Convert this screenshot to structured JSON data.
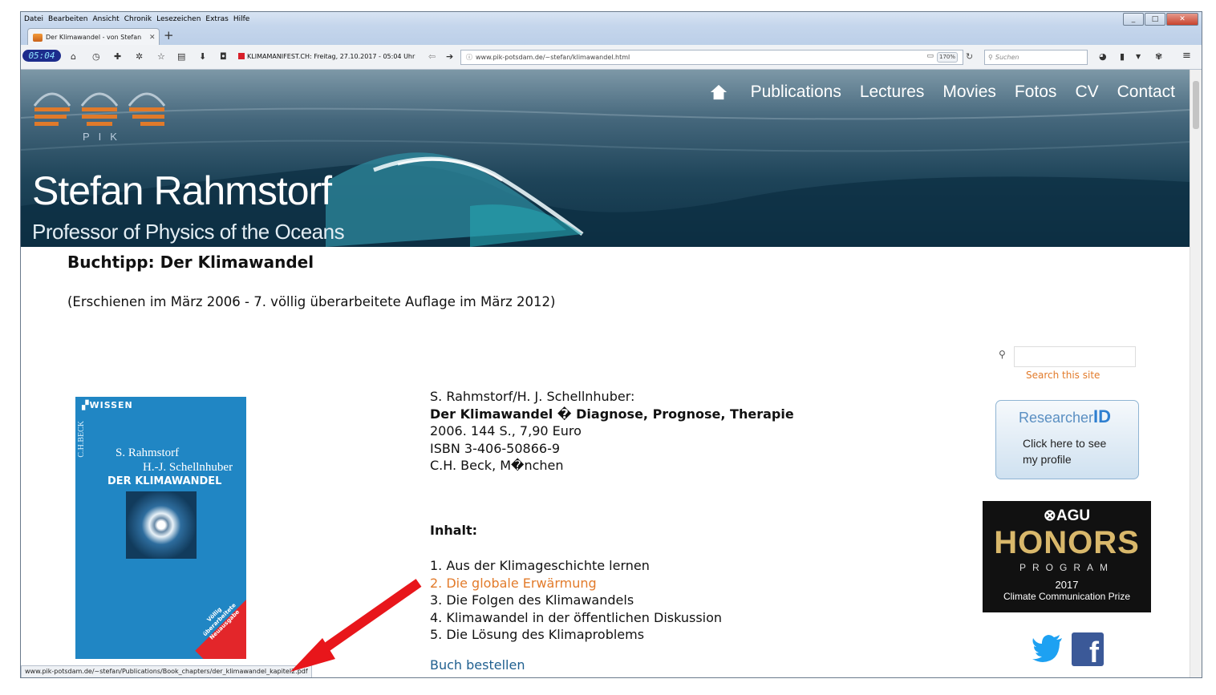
{
  "browser": {
    "menu": [
      "Datei",
      "Bearbeiten",
      "Ansicht",
      "Chronik",
      "Lesezeichen",
      "Extras",
      "Hilfe"
    ],
    "tab_title": "Der Klimawandel - von Stefan",
    "clock": "05:04",
    "klima_text": "KLIMAMANIFEST.CH: Freitag, 27.10.2017 - 05:04 Uhr",
    "url": "www.pik-potsdam.de/~stefan/klimawandel.html",
    "zoom": "170%",
    "search_placeholder": "Suchen",
    "status_url": "www.pik-potsdam.de/~stefan/Publications/Book_chapters/der_klimawandel_kapitel2.pdf"
  },
  "site": {
    "nav": [
      "Publications",
      "Lectures",
      "Movies",
      "Fotos",
      "CV",
      "Contact"
    ],
    "logo_label": "PIK",
    "name": "Stefan Rahmstorf",
    "subtitle": "Professor of Physics of the Oceans"
  },
  "page": {
    "heading": "Buchtipp: Der Klimawandel",
    "published": "(Erschienen im März 2006 - 7. völlig überarbeitete Auflage im März 2012)",
    "bib": {
      "authors": "S. Rahmstorf/H. J. Schellnhuber:",
      "title": "Der Klimawandel � Diagnose, Prognose, Therapie",
      "details": "2006. 144 S., 7,90 Euro",
      "isbn": "ISBN 3-406-50866-9",
      "publisher": "C.H. Beck, M�nchen"
    },
    "inhalt_label": "Inhalt:",
    "toc": [
      "1. Aus der Klimageschichte lernen",
      "2. Die globale Erwärmung",
      "3. Die Folgen des Klimawandels",
      "4. Klimawandel in der öffentlichen Diskussion",
      "5. Die Lösung des Klimaproblems"
    ],
    "buy_link": "Buch bestellen"
  },
  "cover": {
    "series": "WISSEN",
    "publisher": "C.H.BECK",
    "author1": "S. Rahmstorf",
    "author2": "H.-J. Schellnhuber",
    "title": "DER KLIMAWANDEL",
    "badge": "Völlig überarbeitete Neuausgabe"
  },
  "sidebar": {
    "search_label": "Search this site",
    "researcher_id": {
      "title_a": "Researcher",
      "title_b": "ID",
      "line1": "Click here to see",
      "line2": "my profile"
    },
    "agu": {
      "logo": "AGU",
      "honors": "HONORS",
      "program": "PROGRAM",
      "year": "2017",
      "prize": "Climate Communication Prize"
    }
  },
  "colors": {
    "accent": "#e27b2b",
    "link": "#1f5f8f",
    "facebook": "#3b5998",
    "twitter": "#1da1f2",
    "annotation_arrow": "#e8161b"
  }
}
